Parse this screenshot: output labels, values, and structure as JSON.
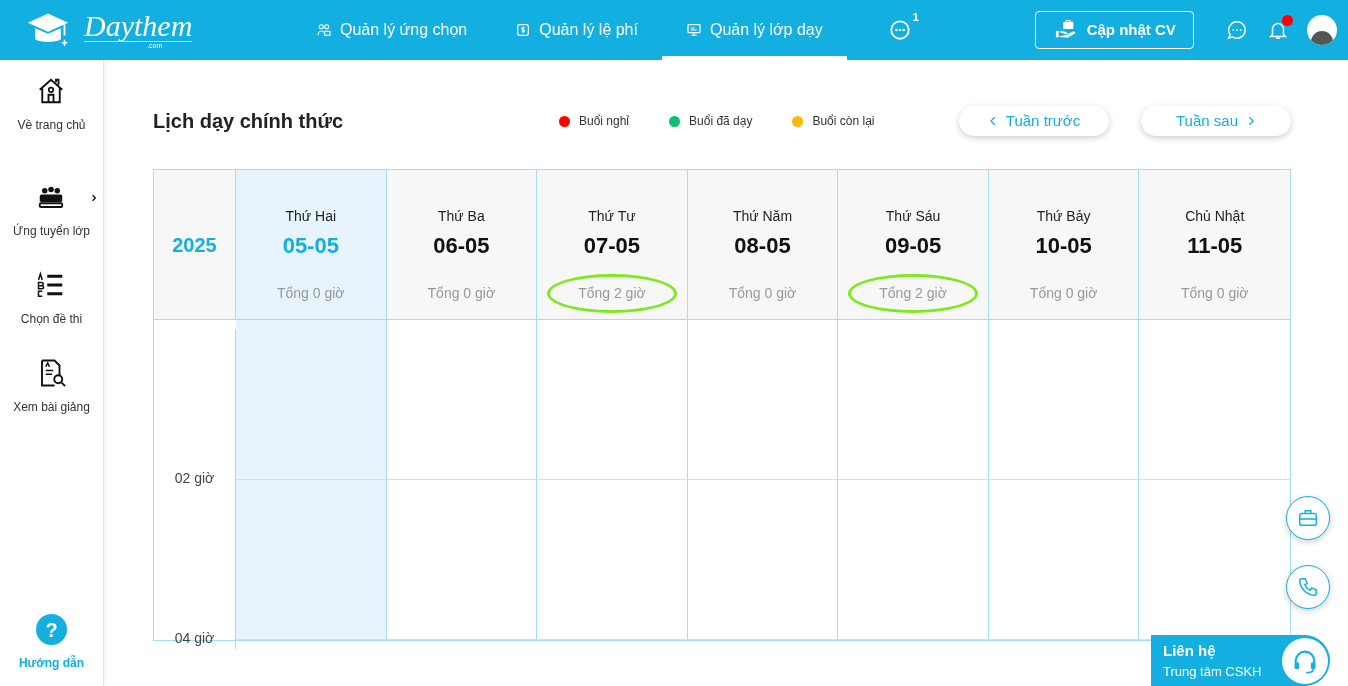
{
  "header": {
    "logo": {
      "name": "Daythem",
      "domain": ".com"
    },
    "nav": [
      {
        "label": "Quản lý ứng chọn",
        "selected": false
      },
      {
        "label": "Quản lý lệ phí",
        "selected": false
      },
      {
        "label": "Quản lý lớp dạy",
        "selected": true
      }
    ],
    "more_badge": "1",
    "cv_button": "Cập nhật CV",
    "notification_dot": true
  },
  "sidebar": {
    "items": [
      {
        "label": "Về trang chủ",
        "has_submenu": false
      },
      {
        "label": "Ứng tuyển lớp",
        "has_submenu": true
      },
      {
        "label": "Chọn đề thi",
        "has_submenu": false
      },
      {
        "label": "Xem bài giảng",
        "has_submenu": false
      }
    ],
    "help": {
      "icon": "?",
      "label": "Hướng dẫn"
    }
  },
  "page": {
    "title": "Lịch dạy chính thức",
    "legend": [
      {
        "label": "Buổi nghỉ",
        "color": "#ff0000"
      },
      {
        "label": "Buổi đã dạy",
        "color": "#0fbf72"
      },
      {
        "label": "Buổi còn lại",
        "color": "#ffb800"
      }
    ],
    "prev_button": "Tuần trước",
    "next_button": "Tuần sau"
  },
  "calendar": {
    "year": "2025",
    "days": [
      {
        "weekday": "Thứ Hai",
        "date": "05-05",
        "total": "Tổng 0 giờ",
        "selected": true,
        "circled": false
      },
      {
        "weekday": "Thứ Ba",
        "date": "06-05",
        "total": "Tổng 0 giờ",
        "selected": false,
        "circled": false
      },
      {
        "weekday": "Thứ Tư",
        "date": "07-05",
        "total": "Tổng 2 giờ",
        "selected": false,
        "circled": true
      },
      {
        "weekday": "Thứ Năm",
        "date": "08-05",
        "total": "Tổng 0 giờ",
        "selected": false,
        "circled": false
      },
      {
        "weekday": "Thứ Sáu",
        "date": "09-05",
        "total": "Tổng 2 giờ",
        "selected": false,
        "circled": true
      },
      {
        "weekday": "Thứ Bảy",
        "date": "10-05",
        "total": "Tổng 0 giờ",
        "selected": false,
        "circled": false
      },
      {
        "weekday": "Chủ Nhật",
        "date": "11-05",
        "total": "Tổng 0 giờ",
        "selected": false,
        "circled": false
      }
    ],
    "hours": [
      "02 giờ",
      "04 giờ"
    ]
  },
  "contact": {
    "title": "Liên hệ",
    "subtitle": "Trung tâm CSKH"
  }
}
